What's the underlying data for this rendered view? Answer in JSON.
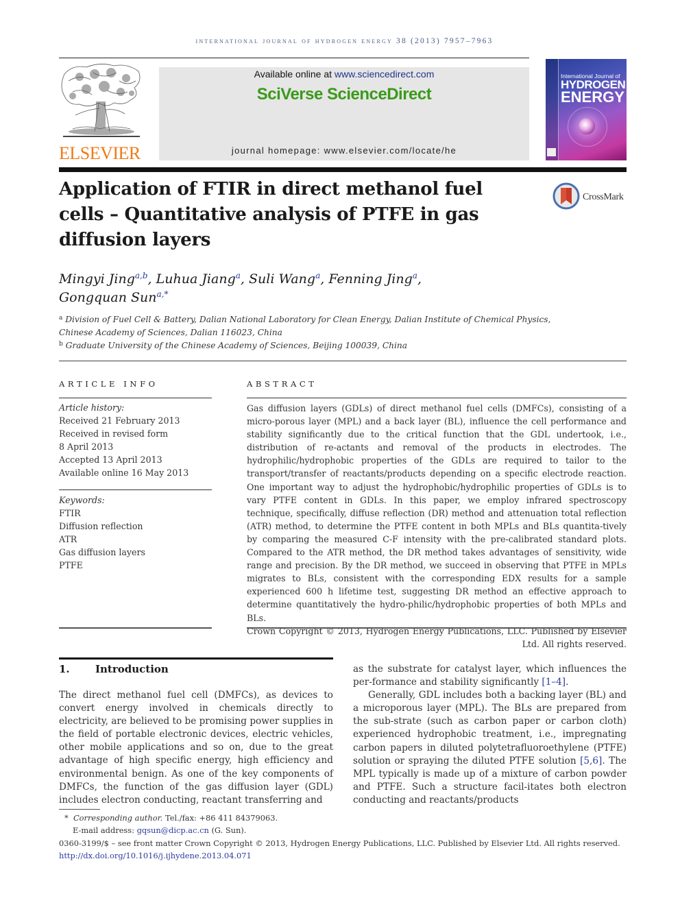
{
  "header": {
    "running_head": "International Journal of Hydrogen Energy 38 (2013) 7957–7963",
    "available_online_prefix": "Available online at ",
    "available_online_link": "www.sciencedirect.com",
    "brand": "SciVerse ScienceDirect",
    "homepage": "journal homepage: www.elsevier.com/locate/he",
    "publisher_logo": "ELSEVIER",
    "cover": {
      "line1": "International Journal of",
      "line2": "HYDROGEN",
      "line3": "ENERGY"
    },
    "crossmark_label": "CrossMark",
    "colors": {
      "elsevier_orange": "#f07a14",
      "sciencedirect_green": "#3a9a1a",
      "link_blue": "#2a3a9a",
      "banner_gray": "#e6e6e6"
    }
  },
  "article": {
    "title": "Application of FTIR in direct methanol fuel cells – Quantitative analysis of PTFE in gas diffusion layers",
    "authors": [
      {
        "name": "Mingyi Jing",
        "sup": "a,b",
        "sep": ", "
      },
      {
        "name": "Luhua Jiang",
        "sup": "a",
        "sep": ", "
      },
      {
        "name": "Suli Wang",
        "sup": "a",
        "sep": ", "
      },
      {
        "name": "Fenning Jing",
        "sup": "a",
        "sep": ","
      },
      {
        "name": "Gongquan Sun",
        "sup": "a,*",
        "sep": ""
      }
    ],
    "affiliations": [
      {
        "label": "a",
        "text": "Division of Fuel Cell & Battery, Dalian National Laboratory for Clean Energy, Dalian Institute of Chemical Physics, Chinese Academy of Sciences, Dalian 116023, China"
      },
      {
        "label": "b",
        "text": "Graduate University of the Chinese Academy of Sciences, Beijing 100039, China"
      }
    ]
  },
  "article_info": {
    "label": "ARTICLE INFO",
    "history_heading": "Article history:",
    "history": [
      "Received 21 February 2013",
      "Received in revised form",
      "8 April 2013",
      "Accepted 13 April 2013",
      "Available online 16 May 2013"
    ],
    "keywords_heading": "Keywords:",
    "keywords": [
      "FTIR",
      "Diffusion reflection",
      "ATR",
      "Gas diffusion layers",
      "PTFE"
    ]
  },
  "abstract": {
    "label": "ABSTRACT",
    "text": "Gas diffusion layers (GDLs) of direct methanol fuel cells (DMFCs), consisting of a micro-porous layer (MPL) and a back layer (BL), influence the cell performance and stability significantly due to the critical function that the GDL undertook, i.e., distribution of re-actants and removal of the products in electrodes. The hydrophilic/hydrophobic properties of the GDLs are required to tailor to the transport/transfer of reactants/products depending on a specific electrode reaction. One important way to adjust the hydrophobic/hydrophilic properties of GDLs is to vary PTFE content in GDLs. In this paper, we employ infrared spectroscopy technique, specifically, diffuse reflection (DR) method and attenuation total reflection (ATR) method, to determine the PTFE content in both MPLs and BLs quantita-tively by comparing the measured C-F intensity with the pre-calibrated standard plots. Compared to the ATR method, the DR method takes advantages of sensitivity, wide range and precision. By the DR method, we succeed in observing that PTFE in MPLs migrates to BLs, consistent with the corresponding EDX results for a sample experienced 600 h lifetime test, suggesting DR method an effective approach to determine quantitatively the hydro-philic/hydrophobic properties of both MPLs and BLs.",
    "copyright": "Crown Copyright © 2013, Hydrogen Energy Publications, LLC. Published by Elsevier Ltd. All rights reserved."
  },
  "introduction": {
    "number": "1.",
    "heading": "Introduction",
    "left_paragraph": "The direct methanol fuel cell (DMFCs), as devices to convert energy involved in chemicals directly to electricity, are believed to be promising power supplies in the field of portable electronic devices, electric vehicles, other mobile applications and so on, due to the great advantage of high specific energy, high efficiency and environmental benign. As one of the key components of DMFCs, the function of the gas diffusion layer (GDL) includes electron conducting, reactant transferring and",
    "right_p1_text": "as the substrate for catalyst layer, which influences the per-formance and stability significantly ",
    "right_p1_cite": "[1–4]",
    "right_p1_end": ".",
    "right_p2_text_a": "Generally, GDL includes both a backing layer (BL) and a microporous layer (MPL). The BLs are prepared from the sub-strate (such as carbon paper or carbon cloth) experienced hydrophobic treatment, i.e., impregnating carbon papers in diluted polytetrafluoroethylene (PTFE) solution or spraying the diluted PTFE solution ",
    "right_p2_cite": "[5,6]",
    "right_p2_text_b": ". The MPL typically is made up of a mixture of carbon powder and PTFE. Such a structure facil-itates both electron conducting and reactants/products"
  },
  "footnotes": {
    "corresponding_label": "Corresponding author.",
    "corresponding_marker": "*",
    "tel": " Tel./fax: +86 411 84379063.",
    "email_prefix": "E-mail address: ",
    "email": "gqsun@dicp.ac.cn",
    "email_suffix": " (G. Sun).",
    "issn_line": "0360-3199/$ – see front matter Crown Copyright © 2013, Hydrogen Energy Publications, LLC. Published by Elsevier Ltd. All rights reserved.",
    "doi": "http://dx.doi.org/10.1016/j.ijhydene.2013.04.071"
  }
}
